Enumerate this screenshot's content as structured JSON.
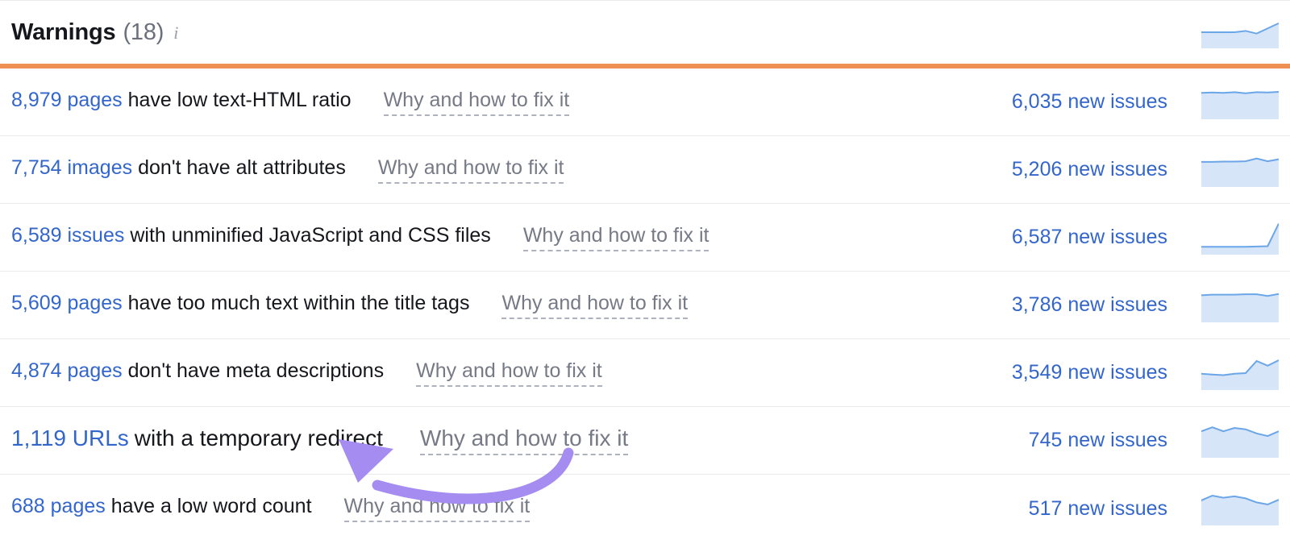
{
  "panel": {
    "title": "Warnings",
    "count": "(18)",
    "info_icon": "info-icon",
    "accent_color": "#ee9054",
    "link_color": "#3366cc",
    "annotation_color": "#a48cf0",
    "header_sparkline": {
      "type": "area",
      "values": [
        50,
        50,
        50,
        50,
        54,
        46,
        62,
        78
      ]
    }
  },
  "rows": [
    {
      "count": "8,979 pages",
      "desc": "have low text-HTML ratio",
      "fix_link": "Why and how to fix it",
      "new_issues": "6,035 new issues",
      "sparkline": {
        "type": "area",
        "values": [
          78,
          79,
          78,
          80,
          77,
          80,
          79,
          81
        ]
      }
    },
    {
      "count": "7,754 images",
      "desc": "don't have alt attributes",
      "fix_link": "Why and how to fix it",
      "new_issues": "5,206 new issues",
      "sparkline": {
        "type": "area",
        "values": [
          74,
          74,
          75,
          75,
          76,
          84,
          76,
          82
        ]
      }
    },
    {
      "count": "6,589 issues",
      "desc": "with unminified JavaScript and CSS files",
      "fix_link": "Why and how to fix it",
      "new_issues": "6,587 new issues",
      "sparkline": {
        "type": "area",
        "values": [
          4,
          4,
          4,
          4,
          4,
          5,
          6,
          96
        ]
      }
    },
    {
      "count": "5,609 pages",
      "desc": "have too much text within the title tags",
      "fix_link": "Why and how to fix it",
      "new_issues": "3,786 new issues",
      "sparkline": {
        "type": "area",
        "values": [
          80,
          82,
          82,
          82,
          83,
          83,
          78,
          84
        ]
      }
    },
    {
      "count": "4,874 pages",
      "desc": "don't have meta descriptions",
      "fix_link": "Why and how to fix it",
      "new_issues": "3,549 new issues",
      "sparkline": {
        "type": "area",
        "values": [
          48,
          46,
          44,
          48,
          50,
          86,
          72,
          88
        ]
      }
    },
    {
      "count": "1,119 URLs",
      "desc": "with a temporary redirect",
      "fix_link": "Why and how to fix it",
      "new_issues": "745 new issues",
      "emphasized": true,
      "sparkline": {
        "type": "area",
        "values": [
          78,
          90,
          78,
          88,
          84,
          72,
          64,
          78
        ]
      }
    },
    {
      "count": "688 pages",
      "desc": "have a low word count",
      "fix_link": "Why and how to fix it",
      "new_issues": "517 new issues",
      "sparkline": {
        "type": "area",
        "values": [
          74,
          88,
          82,
          86,
          80,
          68,
          62,
          76
        ]
      }
    }
  ],
  "annotation": {
    "name": "curved-arrow-annotation",
    "points_to": "1,119 URLs with a temporary redirect"
  }
}
